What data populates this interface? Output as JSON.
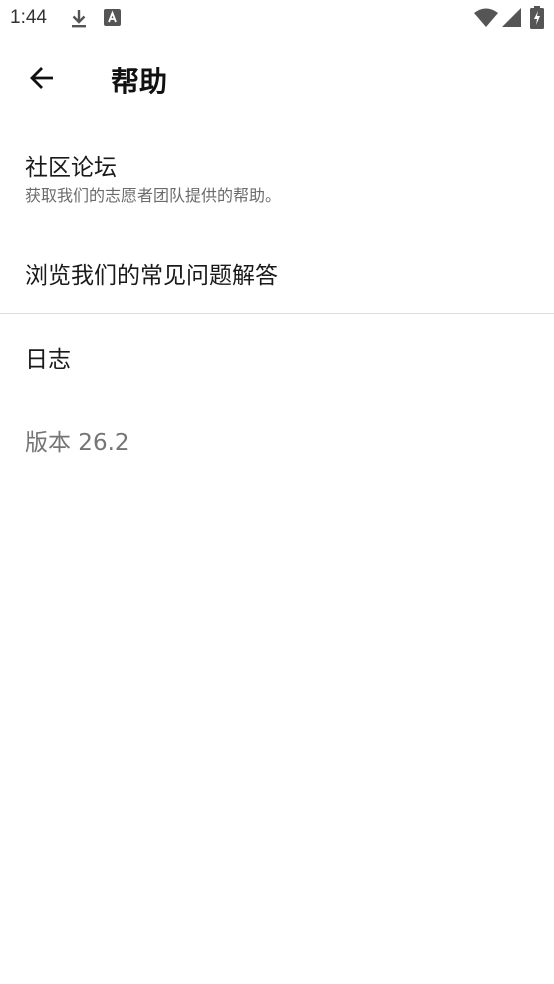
{
  "status_bar": {
    "time": "1:44",
    "icons": [
      "download-icon",
      "app-notification-icon",
      "wifi-icon",
      "signal-icon",
      "battery-charging-icon"
    ]
  },
  "app_bar": {
    "back_icon": "arrow-back-icon",
    "title": "帮助"
  },
  "items": [
    {
      "title": "社区论坛",
      "subtitle": "获取我们的志愿者团队提供的帮助。"
    },
    {
      "title": "浏览我们的常见问题解答"
    },
    {
      "title": "日志"
    }
  ],
  "version": "版本 26.2"
}
